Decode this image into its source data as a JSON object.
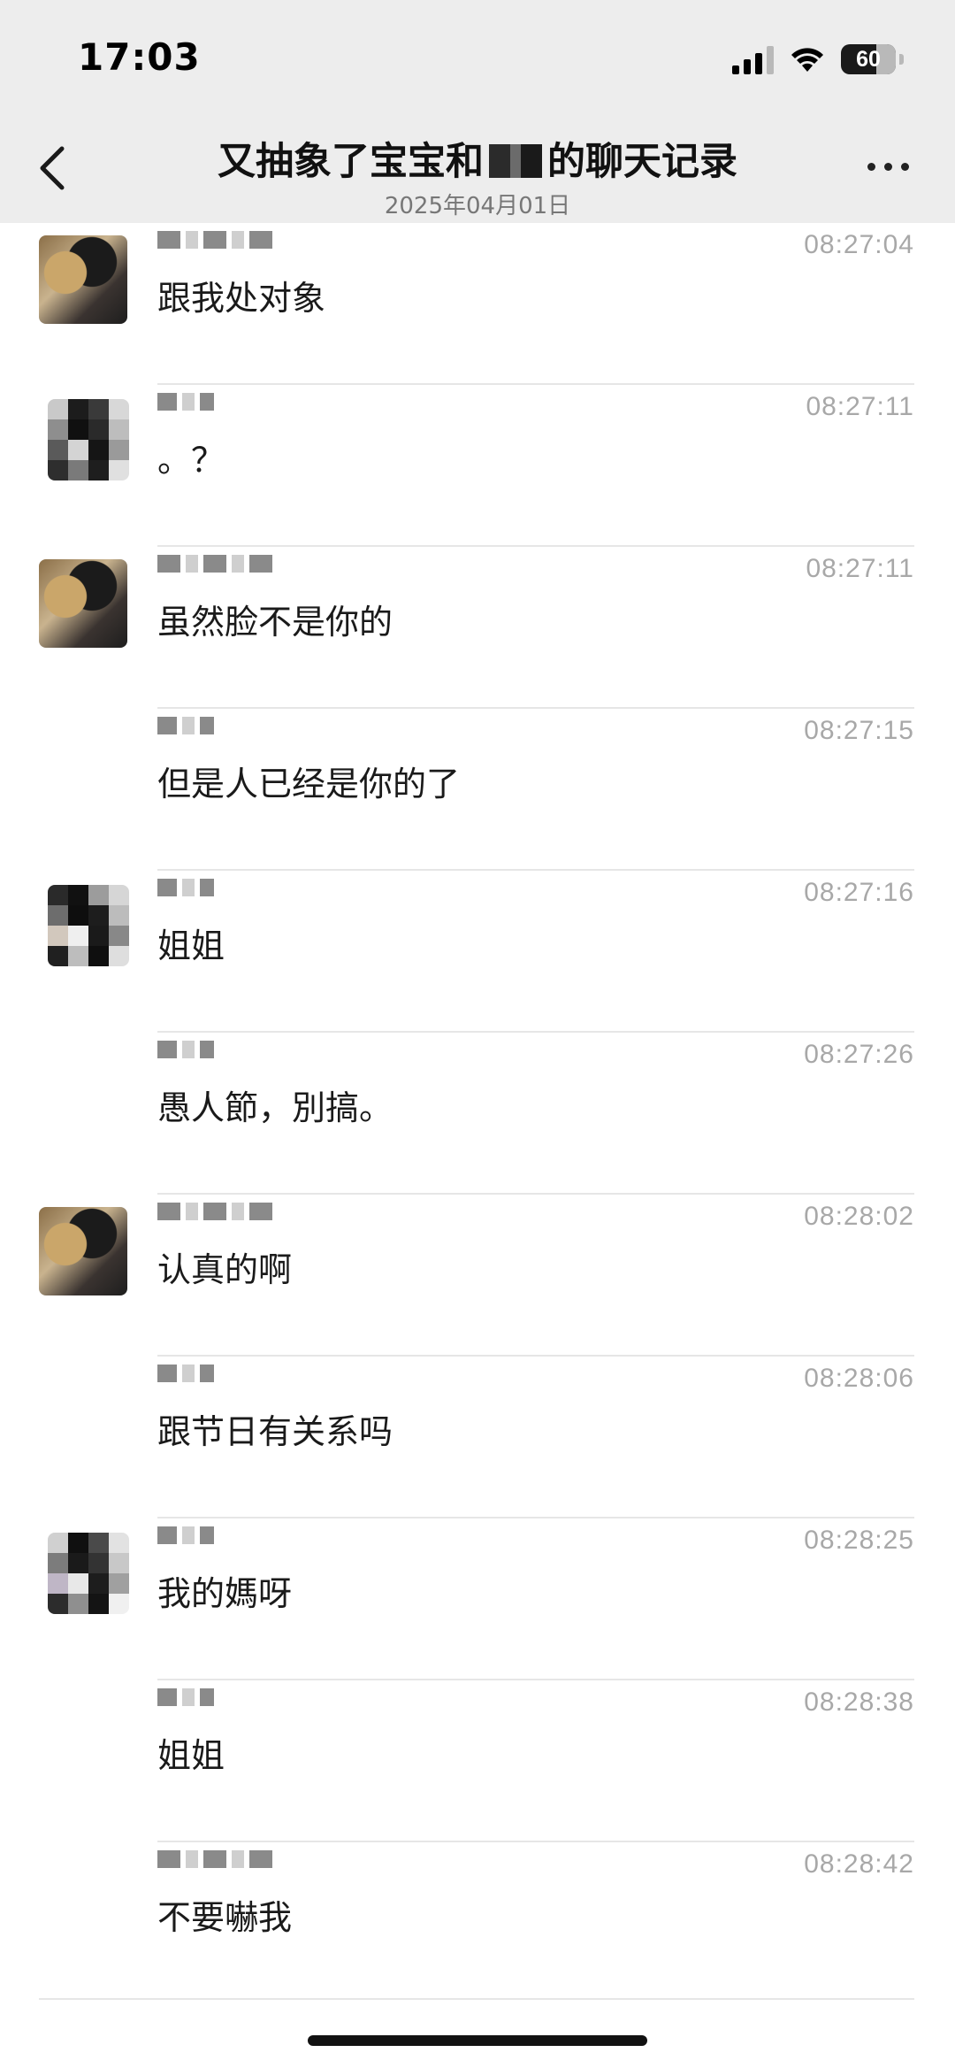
{
  "status": {
    "time": "17:03",
    "battery": "60"
  },
  "header": {
    "title_left": "又抽象了宝宝和",
    "title_right": "的聊天记录",
    "date": "2025年04月01日"
  },
  "messages": [
    {
      "avatar": "photo",
      "time": "08:27:04",
      "text": "跟我处对象",
      "sep": true
    },
    {
      "avatar": "pixel",
      "time": "08:27:11",
      "text": "。？",
      "sep": true
    },
    {
      "avatar": "photo",
      "time": "08:27:11",
      "text": "虽然脸不是你的",
      "sep": true
    },
    {
      "avatar": "none",
      "time": "08:27:15",
      "text": "但是人已经是你的了",
      "sep": true
    },
    {
      "avatar": "pixel",
      "time": "08:27:16",
      "text": "姐姐",
      "sep": true
    },
    {
      "avatar": "none",
      "time": "08:27:26",
      "text": "愚人節，別搞。",
      "sep": true
    },
    {
      "avatar": "photo",
      "time": "08:28:02",
      "text": "认真的啊",
      "sep": true
    },
    {
      "avatar": "none",
      "time": "08:28:06",
      "text": "跟节日有关系吗",
      "sep": true
    },
    {
      "avatar": "pixel",
      "time": "08:28:25",
      "text": "我的媽呀",
      "sep": true
    },
    {
      "avatar": "none",
      "time": "08:28:38",
      "text": "姐姐",
      "sep": true
    },
    {
      "avatar": "none",
      "time": "08:28:42",
      "text": "不要嚇我",
      "sep": false
    }
  ]
}
